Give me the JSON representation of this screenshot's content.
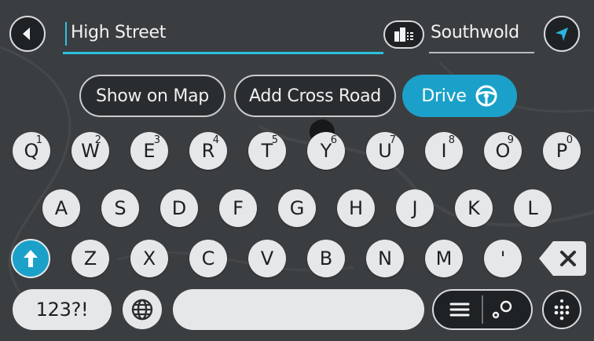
{
  "search": {
    "query": "High Street",
    "city": "Southwold"
  },
  "actions": {
    "show_on_map": "Show on Map",
    "add_cross_road": "Add Cross Road",
    "drive": "Drive"
  },
  "keyboard": {
    "row1": [
      {
        "key": "Q",
        "alt": "1"
      },
      {
        "key": "W",
        "alt": "2"
      },
      {
        "key": "E",
        "alt": "3"
      },
      {
        "key": "R",
        "alt": "4"
      },
      {
        "key": "T",
        "alt": "5"
      },
      {
        "key": "Y",
        "alt": "6"
      },
      {
        "key": "U",
        "alt": "7"
      },
      {
        "key": "I",
        "alt": "8"
      },
      {
        "key": "O",
        "alt": "9"
      },
      {
        "key": "P",
        "alt": "0"
      }
    ],
    "row2": [
      "A",
      "S",
      "D",
      "F",
      "G",
      "H",
      "J",
      "K",
      "L"
    ],
    "row3": [
      "Z",
      "X",
      "C",
      "V",
      "B",
      "N",
      "M",
      "'"
    ],
    "numbers_label": "123?!"
  },
  "icons": {
    "back": "back-arrow-icon",
    "city_search": "city-buildings-icon",
    "navigate": "navigation-arrow-icon",
    "drive": "steering-wheel-icon",
    "shift": "shift-arrow-icon",
    "backspace": "backspace-icon",
    "globe": "globe-icon",
    "list_map": "list-map-toggle-icon",
    "keyboard": "keyboard-icon"
  },
  "colors": {
    "accent": "#1ba1c9",
    "field_underline": "#2cc0e0",
    "key_fill": "#e6e7e8"
  }
}
